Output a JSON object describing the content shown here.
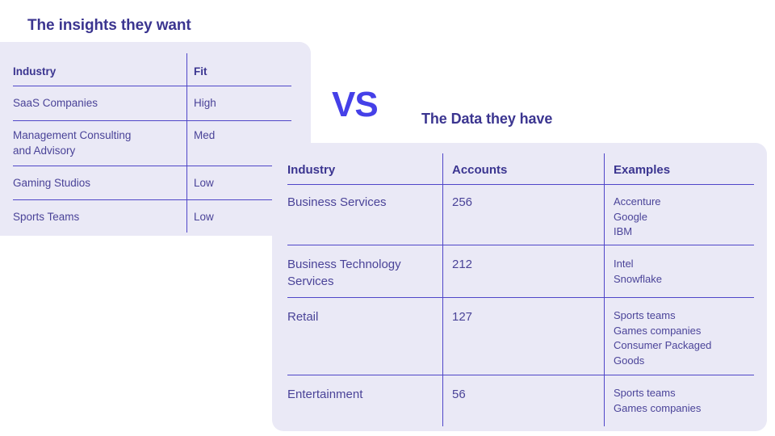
{
  "slide": {
    "background": "#ffffff",
    "panel_bg": "#eae9f6",
    "rule_color": "#4f46c8",
    "heading_color": "#3b3590",
    "vs_color": "#4540e8",
    "body_text_color": "#4a4398"
  },
  "insights": {
    "heading": "The insights they want",
    "columns": [
      "Industry",
      "Fit"
    ],
    "rows": [
      {
        "industry": "SaaS Companies",
        "fit": "High"
      },
      {
        "industry": "Management Consulting\nand Advisory",
        "fit": "Med"
      },
      {
        "industry": "Gaming Studios",
        "fit": "Low"
      },
      {
        "industry": "Sports Teams",
        "fit": "Low"
      }
    ]
  },
  "vs": {
    "label": "VS"
  },
  "data": {
    "heading": "The Data they have",
    "columns": [
      "Industry",
      "Accounts",
      "Examples"
    ],
    "rows": [
      {
        "industry": "Business Services",
        "accounts": "256",
        "examples": "Accenture\nGoogle\nIBM"
      },
      {
        "industry": "Business Technology\nServices",
        "accounts": "212",
        "examples": "Intel\nSnowflake"
      },
      {
        "industry": "Retail",
        "accounts": "127",
        "examples": "Sports teams\nGames companies\nConsumer Packaged\nGoods"
      },
      {
        "industry": "Entertainment",
        "accounts": "56",
        "examples": "Sports teams\nGames companies"
      }
    ]
  }
}
